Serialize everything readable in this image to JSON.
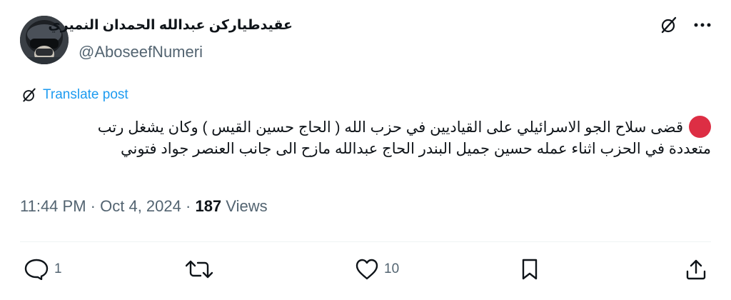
{
  "author": {
    "display_name": "عقيدطياركن عبدالله الحمدان النميري",
    "handle": "@AboseefNumeri",
    "avatar_icon": "pilot-helmet-avatar"
  },
  "header_icons": [
    "grok-icon",
    "more-icon"
  ],
  "translate_label": "Translate post",
  "post": {
    "line1": "قضى سلاح الجو  الاسرائيلي على القياديين  في حزب الله ( الحاج حسين القيس ) وكان يشغل رتب",
    "line2": "متعددة في الحزب اثناء عمله   حسين جميل البندر  الحاج عبدالله مازح الى جانب العنصر جواد فتوني",
    "leading_emoji": "red-circle"
  },
  "meta": {
    "time": "11:44 PM",
    "date": "Oct 4, 2024",
    "views_count": "187",
    "views_label": "Views"
  },
  "actions": {
    "reply_count": "1",
    "like_count": "10"
  },
  "colors": {
    "link": "#1d9bf0",
    "muted": "#536471",
    "text": "#0f1419",
    "red_dot": "#dd2e44"
  }
}
